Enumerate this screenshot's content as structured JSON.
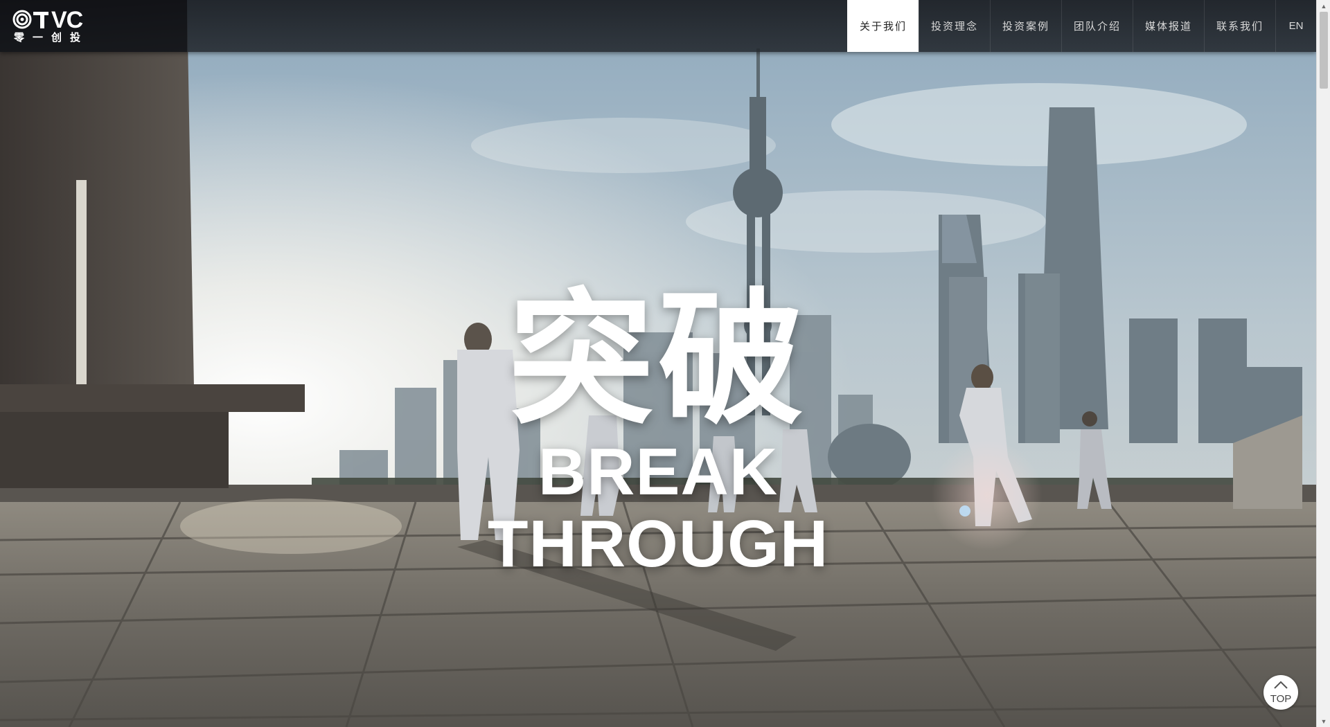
{
  "brand": {
    "logo_text": "VC",
    "logo_subtitle": "零一创投"
  },
  "nav": {
    "items": [
      {
        "label": "关于我们",
        "active": true
      },
      {
        "label": "投资理念",
        "active": false
      },
      {
        "label": "投资案例",
        "active": false
      },
      {
        "label": "团队介绍",
        "active": false
      },
      {
        "label": "媒体报道",
        "active": false
      },
      {
        "label": "联系我们",
        "active": false
      }
    ],
    "lang": "EN"
  },
  "hero": {
    "headline_cn": "突破",
    "headline_en_line1": "BREAK",
    "headline_en_line2": "THROUGH"
  },
  "back_to_top": {
    "label": "TOP",
    "icon": "chevron-up-icon"
  },
  "scrollbar": {
    "up_icon": "scroll-up-arrow-icon",
    "down_icon": "scroll-down-arrow-icon"
  },
  "colors": {
    "nav_bg": "#23282e",
    "nav_active_bg": "#ffffff",
    "nav_text": "#d9d9d9",
    "headline": "#ffffff"
  }
}
